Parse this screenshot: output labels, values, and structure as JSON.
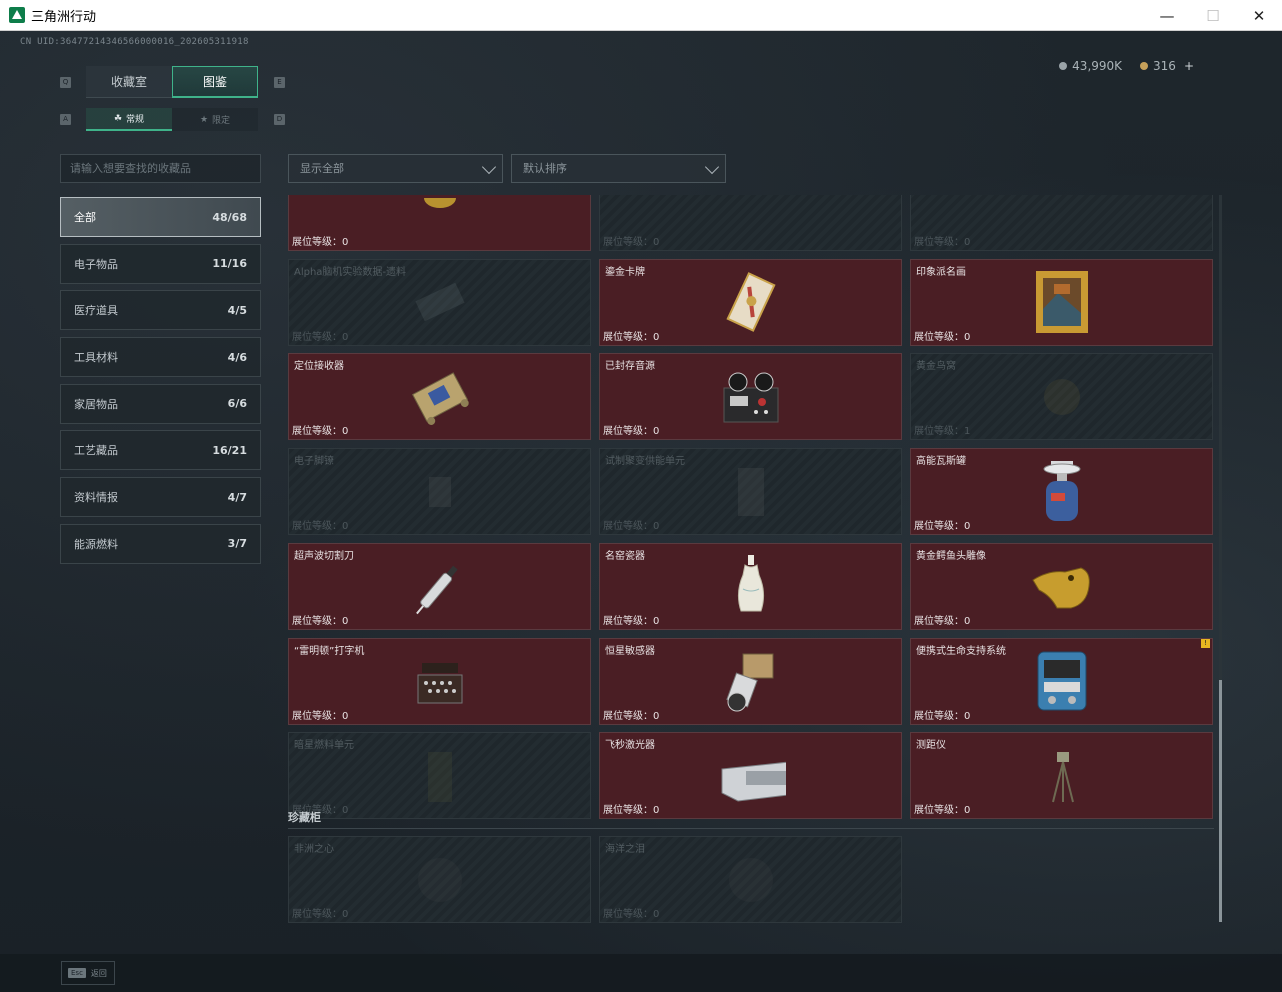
{
  "window": {
    "title": "三角洲行动"
  },
  "uid": "CN UID:36477214346566000016_202605311918",
  "currency": {
    "silver": "43,990K",
    "gold": "316",
    "plus": "+"
  },
  "tabs_main": [
    "收藏室",
    "图鉴"
  ],
  "tabs_sub": [
    "常规",
    "限定"
  ],
  "key_hints": {
    "main_left": "Q",
    "main_right": "E",
    "sub_left": "A",
    "sub_right": "D"
  },
  "search": {
    "placeholder": "请输入想要查找的收藏品"
  },
  "filters": {
    "show": "显示全部",
    "sort": "默认排序"
  },
  "categories": [
    {
      "label": "全部",
      "count": "48/68"
    },
    {
      "label": "电子物品",
      "count": "11/16"
    },
    {
      "label": "医疗道具",
      "count": "4/5"
    },
    {
      "label": "工具材料",
      "count": "4/6"
    },
    {
      "label": "家居物品",
      "count": "6/6"
    },
    {
      "label": "工艺藏品",
      "count": "16/21"
    },
    {
      "label": "资料情报",
      "count": "4/7"
    },
    {
      "label": "能源燃料",
      "count": "3/7"
    }
  ],
  "level_prefix": "展位等级：",
  "cards": [
    {
      "name": "",
      "level": "0",
      "locked": false,
      "icon": "gold-medal-icon"
    },
    {
      "name": "",
      "level": "0",
      "locked": true,
      "icon": ""
    },
    {
      "name": "",
      "level": "0",
      "locked": true,
      "icon": ""
    },
    {
      "name": "Alpha脑机实验数据-遗料",
      "level": "0",
      "locked": true,
      "icon": "data-drive-icon"
    },
    {
      "name": "鎏金卡牌",
      "level": "0",
      "locked": false,
      "icon": "gilded-card-icon"
    },
    {
      "name": "印象派名画",
      "level": "0",
      "locked": false,
      "icon": "framed-painting-icon"
    },
    {
      "name": "定位接收器",
      "level": "0",
      "locked": false,
      "icon": "receiver-icon"
    },
    {
      "name": "已封存音源",
      "level": "0",
      "locked": false,
      "icon": "tape-recorder-icon"
    },
    {
      "name": "黄金鸟窝",
      "level": "1",
      "locked": true,
      "icon": "golden-nest-icon"
    },
    {
      "name": "电子脚镣",
      "level": "0",
      "locked": true,
      "icon": "ankle-monitor-icon"
    },
    {
      "name": "试制聚变供能单元",
      "level": "0",
      "locked": true,
      "icon": "fusion-cell-icon"
    },
    {
      "name": "高能瓦斯罐",
      "level": "0",
      "locked": false,
      "icon": "gas-canister-icon"
    },
    {
      "name": "超声波切割刀",
      "level": "0",
      "locked": false,
      "icon": "ultrasonic-cutter-icon"
    },
    {
      "name": "名窑瓷器",
      "level": "0",
      "locked": false,
      "icon": "porcelain-vase-icon"
    },
    {
      "name": "黄金鳄鱼头雕像",
      "level": "0",
      "locked": false,
      "icon": "gold-crocodile-icon"
    },
    {
      "name": "“雷明顿”打字机",
      "level": "0",
      "locked": false,
      "icon": "typewriter-icon"
    },
    {
      "name": "恒星敏感器",
      "level": "0",
      "locked": false,
      "icon": "star-sensor-icon"
    },
    {
      "name": "便携式生命支持系统",
      "level": "0",
      "locked": false,
      "icon": "life-support-icon",
      "badge": "!"
    },
    {
      "name": "暗星燃料单元",
      "level": "0",
      "locked": true,
      "icon": "fuel-cell-icon"
    },
    {
      "name": "飞秒激光器",
      "level": "0",
      "locked": false,
      "icon": "laser-device-icon"
    },
    {
      "name": "测距仪",
      "level": "0",
      "locked": false,
      "icon": "rangefinder-icon"
    }
  ],
  "section": {
    "title": "珍藏柜"
  },
  "rare_cards": [
    {
      "name": "非洲之心",
      "level": "0",
      "locked": true,
      "icon": "gem-icon"
    },
    {
      "name": "海洋之泪",
      "level": "0",
      "locked": true,
      "icon": "gem-icon"
    }
  ],
  "footer": {
    "esc_key": "Esc",
    "esc_label": "返回"
  }
}
